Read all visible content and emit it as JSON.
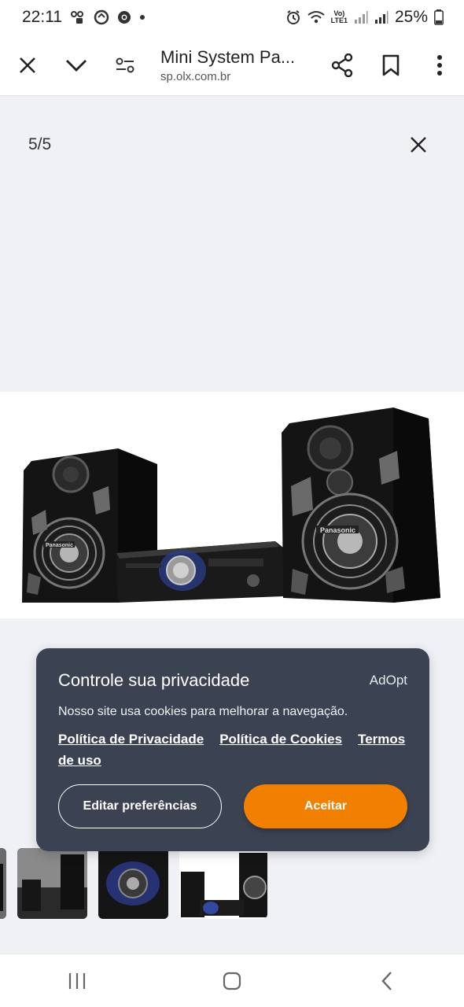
{
  "status_bar": {
    "time": "22:11",
    "network_label_top": "Vo)",
    "network_label_bottom": "LTE1",
    "battery": "25%"
  },
  "browser": {
    "page_title": "Mini System Pa...",
    "url": "sp.olx.com.br"
  },
  "gallery": {
    "counter": "5/5",
    "main_image_alt": "Panasonic",
    "thumbnails": 4
  },
  "cookie_banner": {
    "title": "Controle sua privacidade",
    "brand": "AdOpt",
    "text": "Nosso site usa cookies para melhorar a navegação.",
    "links": {
      "privacy": "Política de Privacidade",
      "cookies": "Política de Cookies",
      "terms": "Termos de uso"
    },
    "edit_button": "Editar preferências",
    "accept_button": "Aceitar",
    "accent_color": "#f28000",
    "background_color": "#3b4251"
  },
  "navbar": {
    "icons": [
      "recent-apps-icon",
      "home-icon",
      "back-icon"
    ]
  }
}
